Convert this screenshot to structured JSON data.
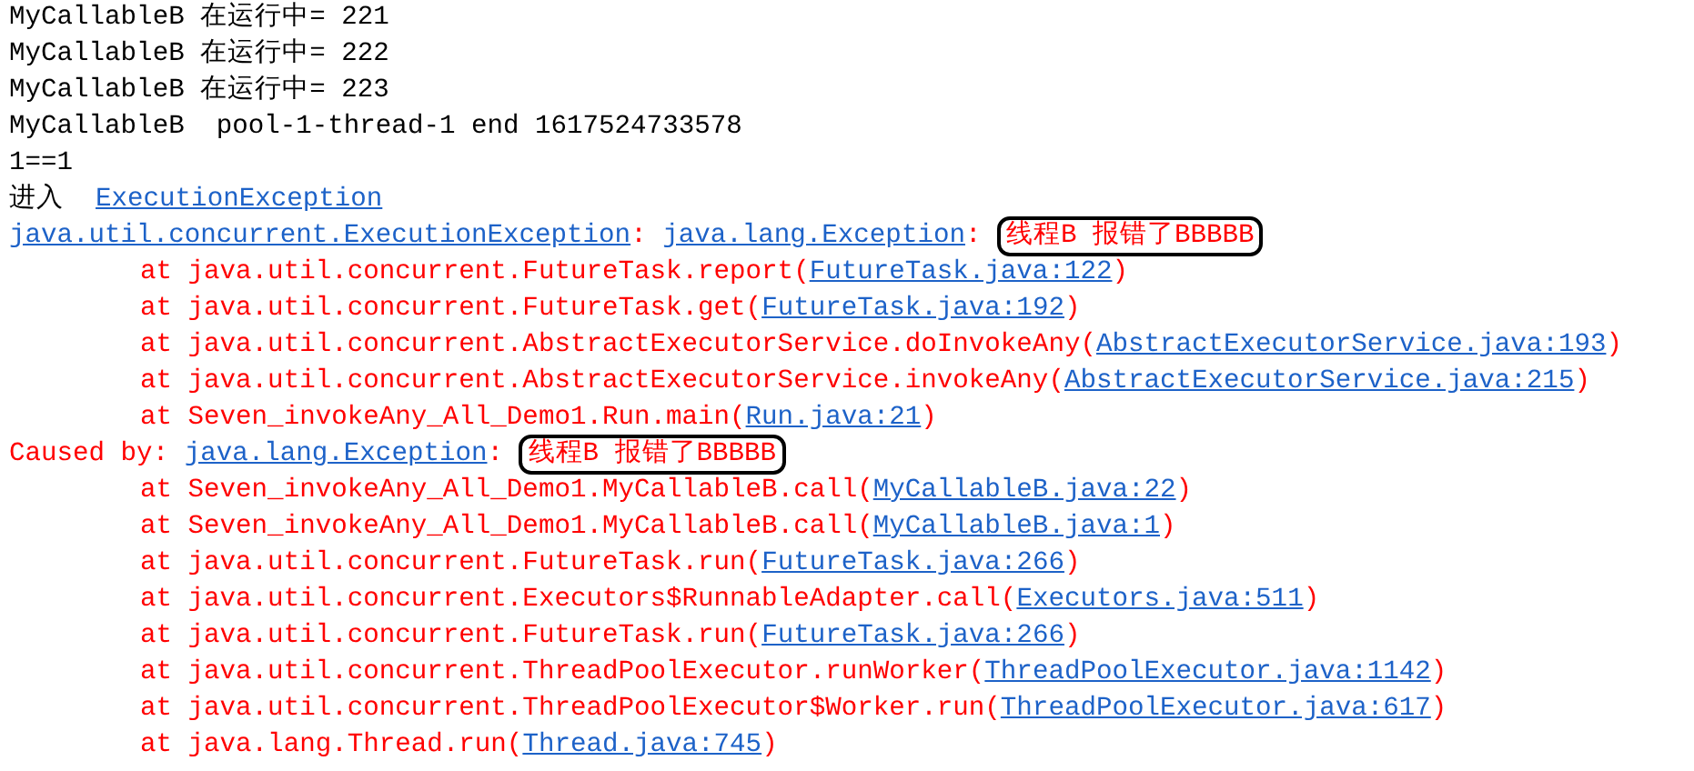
{
  "console": {
    "lines": [
      {
        "kind": "output",
        "segments": [
          {
            "kind": "plain",
            "text": "MyCallableB 在运行中= 221"
          }
        ]
      },
      {
        "kind": "output",
        "segments": [
          {
            "kind": "plain",
            "text": "MyCallableB 在运行中= 222"
          }
        ]
      },
      {
        "kind": "output",
        "segments": [
          {
            "kind": "plain",
            "text": "MyCallableB 在运行中= 223"
          }
        ]
      },
      {
        "kind": "output",
        "segments": [
          {
            "kind": "plain",
            "text": "MyCallableB  pool-1-thread-1 end 1617524733578"
          }
        ]
      },
      {
        "kind": "output",
        "segments": [
          {
            "kind": "plain",
            "text": "1==1"
          }
        ]
      },
      {
        "kind": "output",
        "segments": [
          {
            "kind": "plain",
            "text": "进入  "
          },
          {
            "kind": "link",
            "text": "ExecutionException"
          }
        ]
      },
      {
        "kind": "output",
        "segments": [
          {
            "kind": "link",
            "text": "java.util.concurrent.ExecutionException"
          },
          {
            "kind": "error",
            "text": ": "
          },
          {
            "kind": "link",
            "text": "java.lang.Exception"
          },
          {
            "kind": "error",
            "text": ": "
          },
          {
            "kind": "error",
            "text": "线程B 报错了BBBBB",
            "circled": true
          }
        ]
      },
      {
        "kind": "frame",
        "segments": [
          {
            "kind": "error",
            "text": "at java.util.concurrent.FutureTask.report("
          },
          {
            "kind": "link",
            "text": "FutureTask.java:122"
          },
          {
            "kind": "error",
            "text": ")"
          }
        ]
      },
      {
        "kind": "frame",
        "segments": [
          {
            "kind": "error",
            "text": "at java.util.concurrent.FutureTask.get("
          },
          {
            "kind": "link",
            "text": "FutureTask.java:192"
          },
          {
            "kind": "error",
            "text": ")"
          }
        ]
      },
      {
        "kind": "frame",
        "segments": [
          {
            "kind": "error",
            "text": "at java.util.concurrent.AbstractExecutorService.doInvokeAny("
          },
          {
            "kind": "link",
            "text": "AbstractExecutorService.java:193"
          },
          {
            "kind": "error",
            "text": ")"
          }
        ]
      },
      {
        "kind": "frame",
        "segments": [
          {
            "kind": "error",
            "text": "at java.util.concurrent.AbstractExecutorService.invokeAny("
          },
          {
            "kind": "link",
            "text": "AbstractExecutorService.java:215"
          },
          {
            "kind": "error",
            "text": ")"
          }
        ]
      },
      {
        "kind": "frame",
        "segments": [
          {
            "kind": "error",
            "text": "at Seven_invokeAny_All_Demo1.Run.main("
          },
          {
            "kind": "link",
            "text": "Run.java:21"
          },
          {
            "kind": "error",
            "text": ")"
          }
        ]
      },
      {
        "kind": "output",
        "segments": [
          {
            "kind": "error",
            "text": "Caused by: "
          },
          {
            "kind": "link",
            "text": "java.lang.Exception"
          },
          {
            "kind": "error",
            "text": ": "
          },
          {
            "kind": "error",
            "text": "线程B 报错了BBBBB",
            "circled": true
          }
        ]
      },
      {
        "kind": "frame",
        "segments": [
          {
            "kind": "error",
            "text": "at Seven_invokeAny_All_Demo1.MyCallableB.call("
          },
          {
            "kind": "link",
            "text": "MyCallableB.java:22"
          },
          {
            "kind": "error",
            "text": ")"
          }
        ]
      },
      {
        "kind": "frame",
        "segments": [
          {
            "kind": "error",
            "text": "at Seven_invokeAny_All_Demo1.MyCallableB.call("
          },
          {
            "kind": "link",
            "text": "MyCallableB.java:1"
          },
          {
            "kind": "error",
            "text": ")"
          }
        ]
      },
      {
        "kind": "frame",
        "segments": [
          {
            "kind": "error",
            "text": "at java.util.concurrent.FutureTask.run("
          },
          {
            "kind": "link",
            "text": "FutureTask.java:266"
          },
          {
            "kind": "error",
            "text": ")"
          }
        ]
      },
      {
        "kind": "frame",
        "segments": [
          {
            "kind": "error",
            "text": "at java.util.concurrent.Executors$RunnableAdapter.call("
          },
          {
            "kind": "link",
            "text": "Executors.java:511"
          },
          {
            "kind": "error",
            "text": ")"
          }
        ]
      },
      {
        "kind": "frame",
        "segments": [
          {
            "kind": "error",
            "text": "at java.util.concurrent.FutureTask.run("
          },
          {
            "kind": "link",
            "text": "FutureTask.java:266"
          },
          {
            "kind": "error",
            "text": ")"
          }
        ]
      },
      {
        "kind": "frame",
        "segments": [
          {
            "kind": "error",
            "text": "at java.util.concurrent.ThreadPoolExecutor.runWorker("
          },
          {
            "kind": "link",
            "text": "ThreadPoolExecutor.java:1142"
          },
          {
            "kind": "error",
            "text": ")"
          }
        ]
      },
      {
        "kind": "frame",
        "segments": [
          {
            "kind": "error",
            "text": "at java.util.concurrent.ThreadPoolExecutor$Worker.run("
          },
          {
            "kind": "link",
            "text": "ThreadPoolExecutor.java:617"
          },
          {
            "kind": "error",
            "text": ")"
          }
        ]
      },
      {
        "kind": "frame",
        "segments": [
          {
            "kind": "error",
            "text": "at java.lang.Thread.run("
          },
          {
            "kind": "link",
            "text": "Thread.java:745"
          },
          {
            "kind": "error",
            "text": ")"
          }
        ]
      }
    ]
  }
}
